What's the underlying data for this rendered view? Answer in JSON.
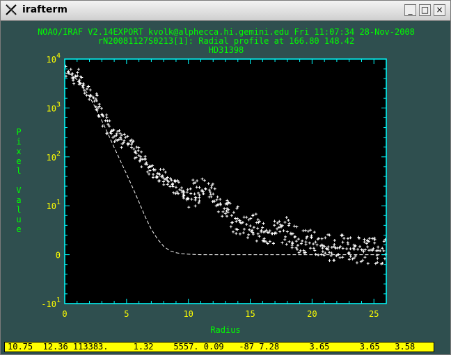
{
  "window": {
    "title": "irafterm",
    "buttons": {
      "minimize": "_",
      "maximize": "□",
      "close": "×"
    }
  },
  "header": {
    "line1": "NOAO/IRAF V2.14EXPORT kvolk@alphecca.hi.gemini.edu Fri 11:07:34 28-Nov-2008",
    "line2": "rN20081127S0213[1]: Radial profile at 166.80 148.42",
    "line3": "HD31398"
  },
  "status_bar": {
    "text": "10.75  12.36 113383.     1.32    5557. 0.09   -87 7.28      3.65      3.65   3.58"
  },
  "colors": {
    "background": "#2f4f4f",
    "axes": "#00ffff",
    "header_text": "#00ff00",
    "tick_labels": "#ffff00",
    "data": "#ffffff",
    "status_bar": "#ffff00"
  },
  "chart_data": {
    "type": "scatter",
    "title": "",
    "xlabel": "Radius",
    "ylabel": "Pixel Value",
    "xlim": [
      0,
      26
    ],
    "ylim": [
      -1,
      4
    ],
    "y_scale": "asinh-like log (tick labels 10^-1 … 10^4, 0 at 0)",
    "x_ticks": [
      "0",
      "5",
      "10",
      "15",
      "20",
      "25"
    ],
    "y_ticks": [
      {
        "base": "-10",
        "exp": "1",
        "pos": -1
      },
      {
        "base": "0",
        "exp": "",
        "pos": 0
      },
      {
        "base": "10",
        "exp": "1",
        "pos": 1
      },
      {
        "base": "10",
        "exp": "2",
        "pos": 2
      },
      {
        "base": "10",
        "exp": "3",
        "pos": 3
      },
      {
        "base": "10",
        "exp": "4",
        "pos": 4
      }
    ],
    "series": [
      {
        "marker": "plus",
        "x": [
          0.3,
          0.6,
          0.9,
          1.2,
          1.5,
          1.8,
          2.1,
          2.4,
          2.7,
          3.0,
          3.3,
          3.6,
          3.9,
          4.2,
          4.5,
          4.8,
          5.1,
          5.4,
          5.7,
          6.0,
          6.3,
          6.6,
          6.9,
          7.2,
          7.5,
          7.8,
          8.1,
          8.4,
          8.7,
          9.0,
          9.3,
          9.6,
          9.9,
          10.2,
          10.5,
          10.8,
          11.1,
          11.4,
          11.7,
          12.0,
          12.3,
          12.6,
          12.9,
          13.2,
          13.5,
          13.8,
          14.1,
          14.4,
          14.7,
          15.0,
          15.3,
          15.6,
          15.9,
          16.2,
          16.5,
          16.8,
          17.1,
          17.4,
          17.7,
          18.0,
          18.3,
          18.6,
          18.9,
          19.2,
          19.5,
          19.8,
          20.1,
          20.4,
          20.7,
          21.0,
          21.3,
          21.6,
          21.9,
          22.2,
          22.5,
          22.8,
          23.1,
          23.4,
          23.7,
          24.0,
          24.3,
          24.6,
          24.9,
          25.2,
          25.5,
          25.8
        ],
        "y": [
          3.73,
          3.7,
          3.64,
          3.57,
          3.5,
          3.39,
          3.26,
          3.14,
          3.0,
          2.87,
          2.74,
          2.63,
          2.54,
          2.47,
          2.4,
          2.33,
          2.27,
          2.19,
          2.11,
          2.03,
          1.95,
          1.88,
          1.8,
          1.73,
          1.66,
          1.6,
          1.54,
          1.49,
          1.43,
          1.38,
          1.33,
          1.3,
          1.28,
          1.25,
          1.24,
          1.26,
          1.3,
          1.34,
          1.32,
          1.24,
          1.12,
          1.02,
          0.94,
          0.87,
          0.8,
          0.74,
          0.7,
          0.66,
          0.62,
          0.59,
          0.56,
          0.54,
          0.5,
          0.47,
          0.45,
          0.43,
          0.44,
          0.47,
          0.49,
          0.47,
          0.42,
          0.36,
          0.32,
          0.28,
          0.26,
          0.24,
          0.22,
          0.2,
          0.18,
          0.17,
          0.16,
          0.15,
          0.14,
          0.14,
          0.13,
          0.12,
          0.12,
          0.11,
          0.11,
          0.1,
          0.1,
          0.09,
          0.09,
          0.08,
          0.08,
          0.08
        ]
      },
      {
        "marker": "dashed-line",
        "x": [
          0,
          0.5,
          1.0,
          1.5,
          2.0,
          2.5,
          3.0,
          3.5,
          4.0,
          4.5,
          5.0,
          5.5,
          6.0,
          6.5,
          7.0,
          7.5,
          8.0,
          8.5,
          9.0,
          9.5,
          10.0,
          11.0,
          12.0,
          14.0,
          16.0,
          18.0,
          20.0,
          22.0,
          24.0,
          26.0
        ],
        "y": [
          3.72,
          3.68,
          3.58,
          3.43,
          3.23,
          3.0,
          2.74,
          2.47,
          2.19,
          1.92,
          1.65,
          1.37,
          1.08,
          0.78,
          0.52,
          0.32,
          0.17,
          0.08,
          0.04,
          0.02,
          0.01,
          0.0,
          0.0,
          0.0,
          0.0,
          0.0,
          0.0,
          0.0,
          0.0,
          0.0
        ]
      }
    ]
  }
}
